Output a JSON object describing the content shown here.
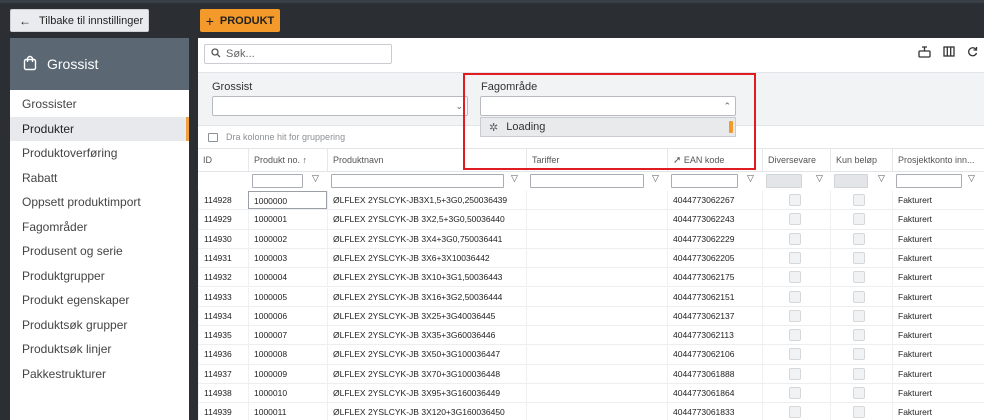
{
  "nav": {
    "back_label": "Tilbake til innstillinger",
    "section_title": "Grossist",
    "items": [
      {
        "label": "Grossister",
        "active": false
      },
      {
        "label": "Produkter",
        "active": true
      },
      {
        "label": "Produktoverføring",
        "active": false
      },
      {
        "label": "Rabatt",
        "active": false
      },
      {
        "label": "Oppsett produktimport",
        "active": false
      },
      {
        "label": "Fagområder",
        "active": false
      },
      {
        "label": "Produsent og serie",
        "active": false
      },
      {
        "label": "Produktgrupper",
        "active": false
      },
      {
        "label": "Produkt egenskaper",
        "active": false
      },
      {
        "label": "Produktsøk grupper",
        "active": false
      },
      {
        "label": "Produktsøk linjer",
        "active": false
      },
      {
        "label": "Pakkestrukturer",
        "active": false
      }
    ]
  },
  "toolbar": {
    "add_label": "PRODUKT",
    "search_placeholder": "Søk..."
  },
  "filters": {
    "grossist_label": "Grossist",
    "fagomrade_label": "Fagområde",
    "loading_label": "Loading"
  },
  "grid": {
    "group_hint": "Dra kolonne hit for gruppering",
    "columns": [
      "ID",
      "Produkt no. ↑",
      "Produktnavn",
      "Tariffer",
      "EAN kode",
      "Diversevare",
      "Kun beløp",
      "Prosjektkonto inn..."
    ],
    "rows": [
      {
        "id": "114928",
        "no": "1000000",
        "name": "ØLFLEX 2YSLCYK-JB3X1,5+3G0,250036439",
        "ean": "4044773062267",
        "konto": "Fakturert"
      },
      {
        "id": "114929",
        "no": "1000001",
        "name": "ØLFLEX 2YSLCYK-JB 3X2,5+3G0,50036440",
        "ean": "4044773062243",
        "konto": "Fakturert"
      },
      {
        "id": "114930",
        "no": "1000002",
        "name": "ØLFLEX 2YSLCYK-JB 3X4+3G0,750036441",
        "ean": "4044773062229",
        "konto": "Fakturert"
      },
      {
        "id": "114931",
        "no": "1000003",
        "name": "ØLFLEX 2YSLCYK-JB 3X6+3X10036442",
        "ean": "4044773062205",
        "konto": "Fakturert"
      },
      {
        "id": "114932",
        "no": "1000004",
        "name": "ØLFLEX 2YSLCYK-JB 3X10+3G1,50036443",
        "ean": "4044773062175",
        "konto": "Fakturert"
      },
      {
        "id": "114933",
        "no": "1000005",
        "name": "ØLFLEX 2YSLCYK-JB 3X16+3G2,50036444",
        "ean": "4044773062151",
        "konto": "Fakturert"
      },
      {
        "id": "114934",
        "no": "1000006",
        "name": "ØLFLEX 2YSLCYK-JB 3X25+3G40036445",
        "ean": "4044773062137",
        "konto": "Fakturert"
      },
      {
        "id": "114935",
        "no": "1000007",
        "name": "ØLFLEX 2YSLCYK-JB 3X35+3G60036446",
        "ean": "4044773062113",
        "konto": "Fakturert"
      },
      {
        "id": "114936",
        "no": "1000008",
        "name": "ØLFLEX 2YSLCYK-JB 3X50+3G100036447",
        "ean": "4044773062106",
        "konto": "Fakturert"
      },
      {
        "id": "114937",
        "no": "1000009",
        "name": "ØLFLEX 2YSLCYK-JB 3X70+3G100036448",
        "ean": "4044773061888",
        "konto": "Fakturert"
      },
      {
        "id": "114938",
        "no": "1000010",
        "name": "ØLFLEX 2YSLCYK-JB 3X95+3G160036449",
        "ean": "4044773061864",
        "konto": "Fakturert"
      },
      {
        "id": "114939",
        "no": "1000011",
        "name": "ØLFLEX 2YSLCYK-JB 3X120+3G160036450",
        "ean": "4044773061833",
        "konto": "Fakturert"
      }
    ]
  },
  "colors": {
    "accent": "#f39a2a",
    "sidebar_header": "#5b6874",
    "highlight": "#e11b22"
  }
}
